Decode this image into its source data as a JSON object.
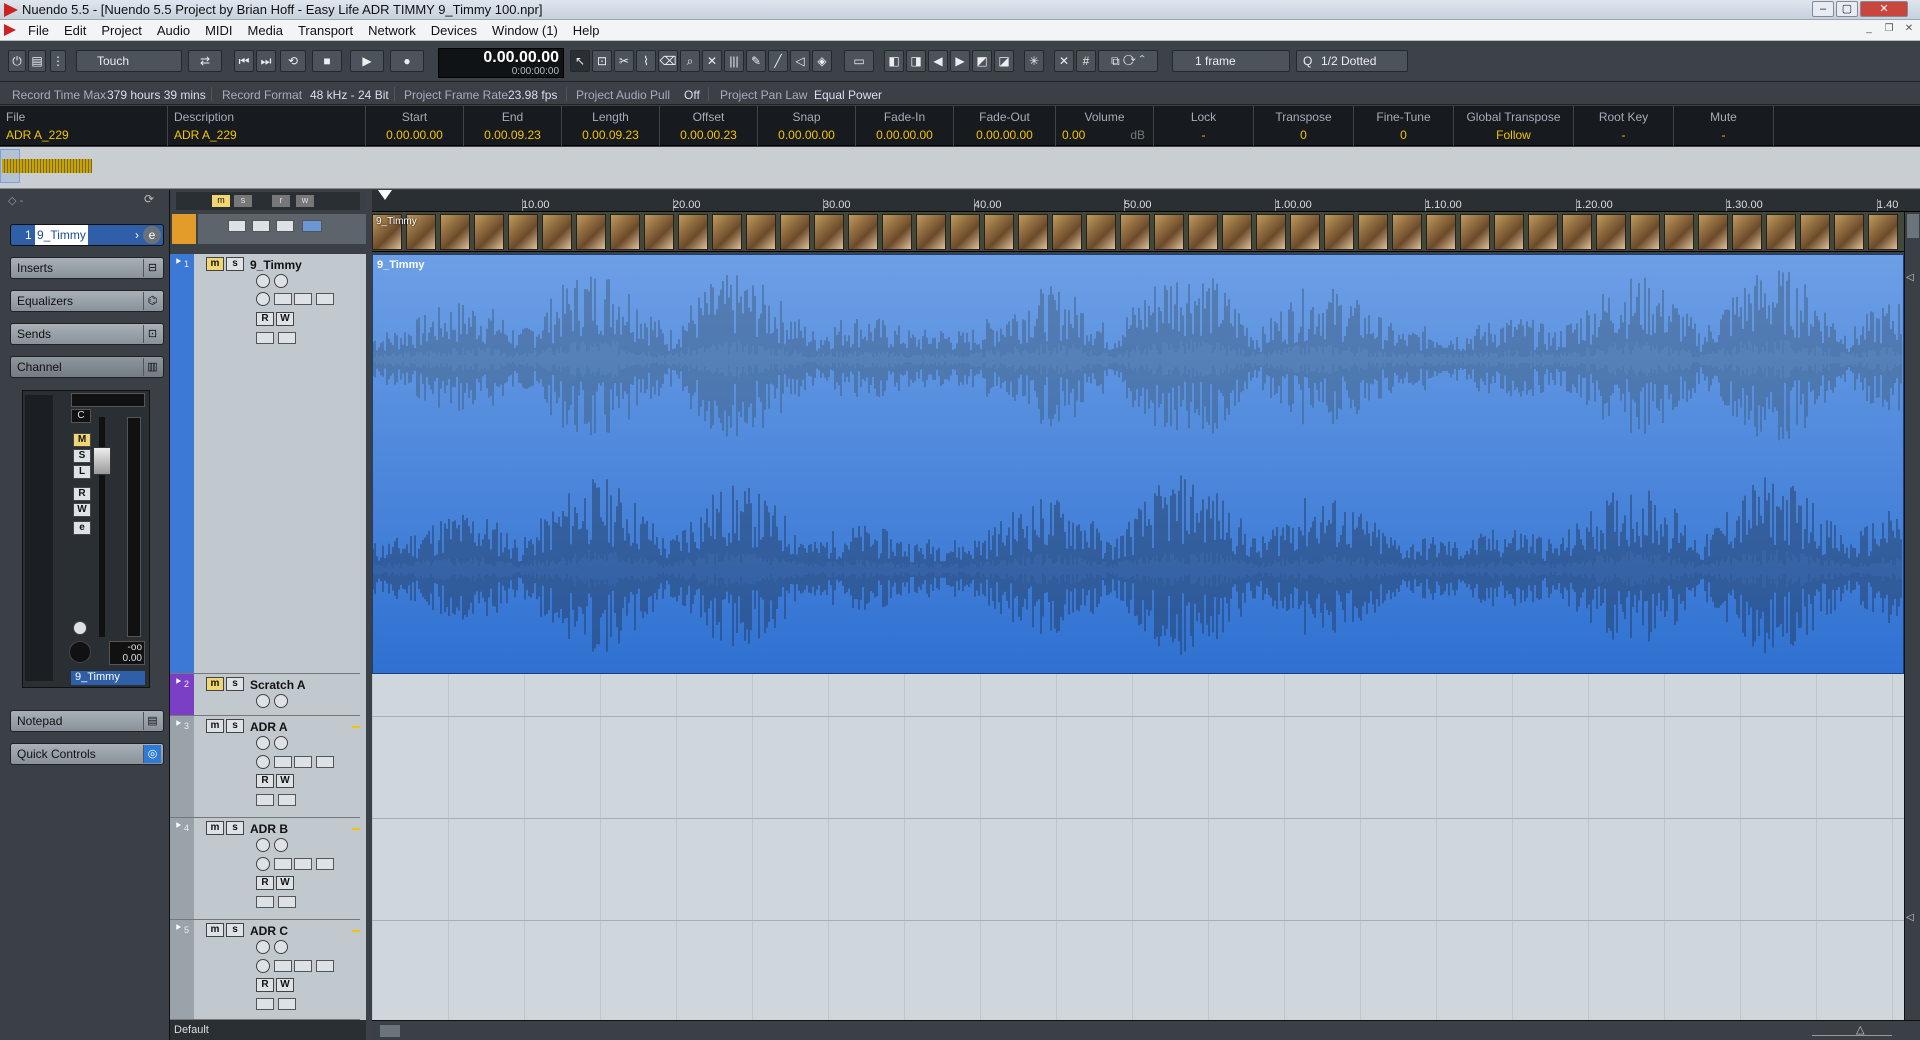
{
  "window": {
    "title": "Nuendo 5.5 - [Nuendo 5.5 Project by Brian Hoff - Easy Life ADR TIMMY 9_Timmy 100.npr]"
  },
  "menu": [
    "File",
    "Edit",
    "Project",
    "Audio",
    "MIDI",
    "Media",
    "Transport",
    "Network",
    "Devices",
    "Window (1)",
    "Help"
  ],
  "toolbar": {
    "automation_mode": "Touch",
    "time_main": "0.00.00.00",
    "time_sub": "0:00:00:00",
    "nudge": "1 frame",
    "quantize": "1/2 Dotted"
  },
  "status": {
    "record_time_label": "Record Time Max",
    "record_time": "379 hours 39 mins",
    "record_format_label": "Record Format",
    "record_format": "48 kHz - 24 Bit",
    "frame_rate_label": "Project Frame Rate",
    "frame_rate": "23.98 fps",
    "audio_pull_label": "Project Audio Pull",
    "audio_pull": "Off",
    "pan_law_label": "Project Pan Law",
    "pan_law": "Equal Power"
  },
  "info": [
    {
      "h": "File",
      "v": "ADR A_229"
    },
    {
      "h": "Description",
      "v": "ADR A_229"
    },
    {
      "h": "Start",
      "v": "0.00.00.00"
    },
    {
      "h": "End",
      "v": "0.00.09.23"
    },
    {
      "h": "Length",
      "v": "0.00.09.23"
    },
    {
      "h": "Offset",
      "v": "0.00.00.23"
    },
    {
      "h": "Snap",
      "v": "0.00.00.00"
    },
    {
      "h": "Fade-In",
      "v": "0.00.00.00"
    },
    {
      "h": "Fade-Out",
      "v": "0.00.00.00"
    },
    {
      "h": "Volume",
      "v": "0.00",
      "u": "dB"
    },
    {
      "h": "Lock",
      "v": "-"
    },
    {
      "h": "Transpose",
      "v": "0"
    },
    {
      "h": "Fine-Tune",
      "v": "0"
    },
    {
      "h": "Global Transpose",
      "v": "Follow"
    },
    {
      "h": "Root Key",
      "v": "-"
    },
    {
      "h": "Mute",
      "v": "-"
    }
  ],
  "inspector": {
    "track": "9_Timmy",
    "track_num": "1",
    "sections": [
      "Inserts",
      "Equalizers",
      "Sends",
      "Channel",
      "Notepad",
      "Quick Controls"
    ],
    "pan": "C",
    "volume": "0.00",
    "peak": "-oo",
    "strip_name": "9_Timmy",
    "preset": "Default"
  },
  "ruler": {
    "labels": [
      "10.00",
      "20.00",
      "30.00",
      "40.00",
      "50.00",
      "1.00.00",
      "1.10.00",
      "1.20.00",
      "1.30.00",
      "1.40"
    ]
  },
  "video_clip": "9_Timmy",
  "tracks": [
    {
      "num": "1",
      "name": "9_Timmy",
      "color": "#3c79d6"
    },
    {
      "num": "2",
      "name": "Scratch A",
      "color": "#7a3fc4"
    },
    {
      "num": "3",
      "name": "ADR A",
      "color": "#9aa3aa"
    },
    {
      "num": "4",
      "name": "ADR B",
      "color": "#9aa3aa"
    },
    {
      "num": "5",
      "name": "ADR C",
      "color": "#9aa3aa"
    }
  ],
  "event": {
    "name": "9_Timmy"
  },
  "button_labels": {
    "mute": "m",
    "solo": "s",
    "read": "R",
    "write": "W",
    "edit": "e",
    "mute_cap": "M",
    "solo_cap": "S",
    "listen": "L"
  },
  "icons": [
    "close-icon",
    "maximize-icon",
    "minimize-icon",
    "play-icon",
    "stop-icon",
    "record-icon",
    "cycle-icon",
    "arrow-tool-icon",
    "range-tool-icon",
    "split-tool-icon",
    "glue-tool-icon",
    "erase-tool-icon",
    "zoom-tool-icon",
    "mute-tool-icon",
    "draw-tool-icon",
    "snap-icon",
    "grid-icon",
    "quantize-icon"
  ]
}
